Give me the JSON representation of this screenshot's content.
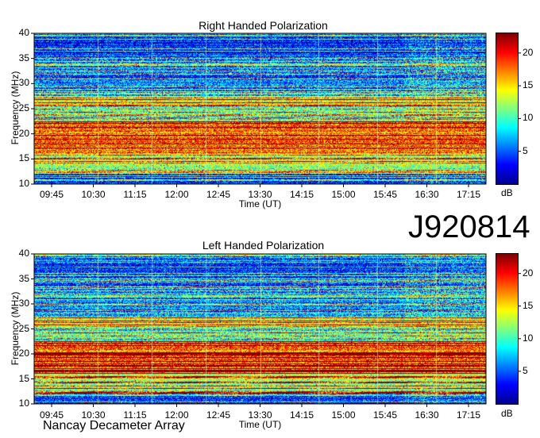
{
  "observation_id": "J920814",
  "credit": "Nancay Decameter Array",
  "chart_data": [
    {
      "type": "heatmap",
      "title": "Right Handed Polarization",
      "xlabel": "Time (UT)",
      "ylabel": "Frequency (MHz)",
      "x_ticks": [
        "09:45",
        "10:30",
        "11:15",
        "12:00",
        "12:45",
        "13:30",
        "14:15",
        "15:00",
        "15:45",
        "16:30",
        "17:15"
      ],
      "y_ticks": [
        10,
        15,
        20,
        25,
        30,
        35,
        40
      ],
      "ylim": [
        10,
        40
      ],
      "colorbar": {
        "label": "dB",
        "ticks": [
          5,
          10,
          15,
          20
        ],
        "range": [
          0,
          23
        ]
      },
      "colormap": [
        "#00008f",
        "#0000ff",
        "#0080ff",
        "#00ffff",
        "#80ff80",
        "#ffff00",
        "#ff8000",
        "#ff0000",
        "#800000"
      ]
    },
    {
      "type": "heatmap",
      "title": "Left Handed Polarization",
      "xlabel": "Time (UT)",
      "ylabel": "Frequency (MHz)",
      "x_ticks": [
        "09:45",
        "10:30",
        "11:15",
        "12:00",
        "12:45",
        "13:30",
        "14:15",
        "15:00",
        "15:45",
        "16:30",
        "17:15"
      ],
      "y_ticks": [
        10,
        15,
        20,
        25,
        30,
        35,
        40
      ],
      "ylim": [
        10,
        40
      ],
      "colorbar": {
        "label": "dB",
        "ticks": [
          5,
          10,
          15,
          20
        ],
        "range": [
          0,
          23
        ]
      },
      "colormap": [
        "#00008f",
        "#0000ff",
        "#0080ff",
        "#00ffff",
        "#80ff80",
        "#ffff00",
        "#ff8000",
        "#ff0000",
        "#800000"
      ]
    }
  ]
}
